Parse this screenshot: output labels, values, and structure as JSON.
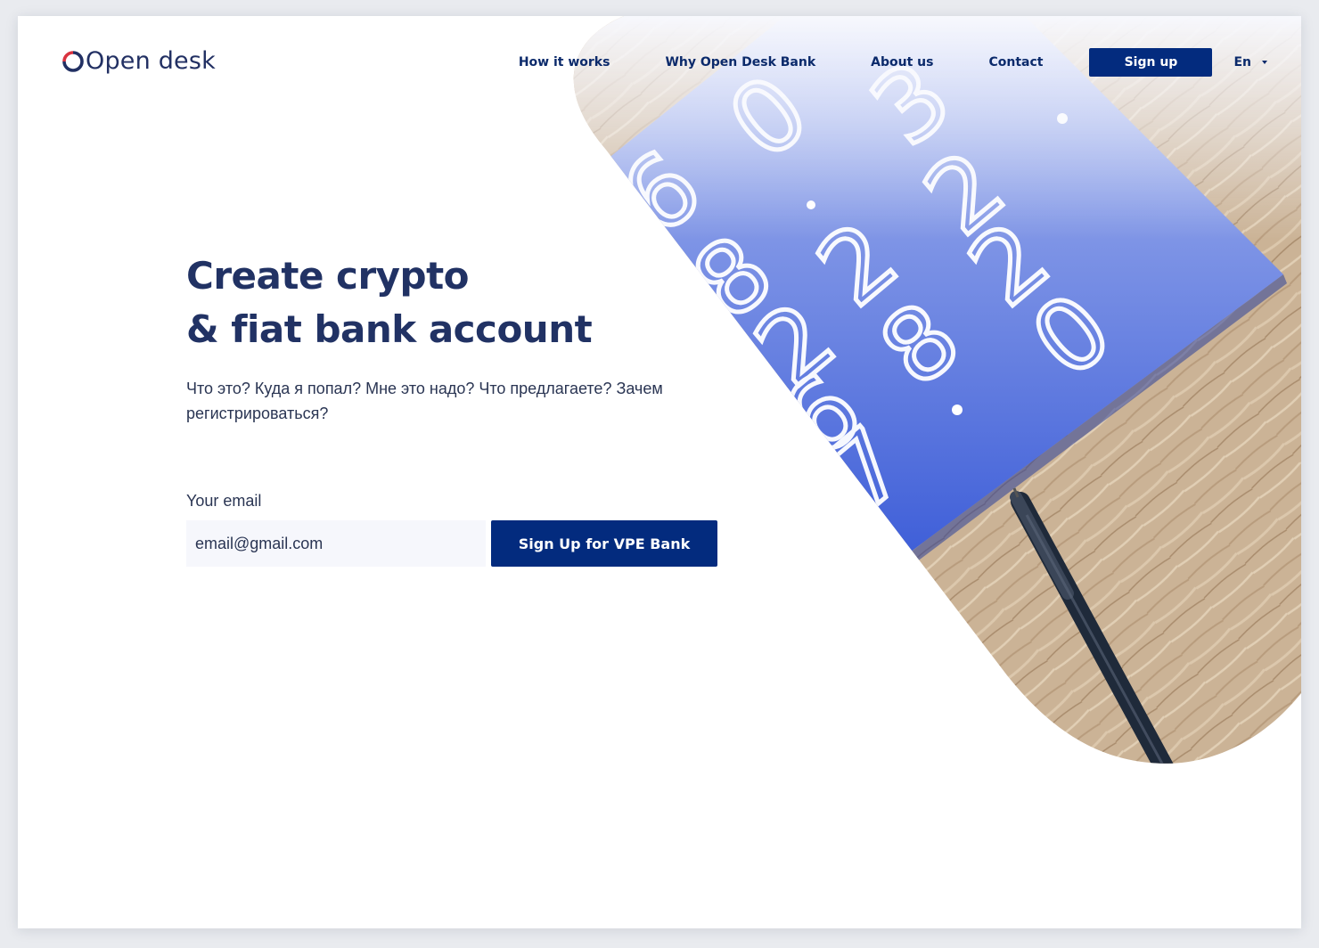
{
  "brand": {
    "logo_text": "Open desk",
    "logo_icon": "open-desk-logo-mark"
  },
  "nav": {
    "links": [
      "How it works",
      "Why Open Desk Bank",
      "About us",
      "Contact"
    ],
    "signup_label": "Sign up",
    "language": "En",
    "language_icon": "chevron-down-icon"
  },
  "hero": {
    "title_line1": "Create crypto",
    "title_line2": "& fiat bank account",
    "subtitle": "Что это? Куда я попал? Мне это надо? Что предлагаете? Зачем регистрироваться?"
  },
  "form": {
    "email_label": "Your email",
    "email_placeholder": "email@gmail.com",
    "submit_label": "Sign Up for VPE Bank"
  },
  "illustration": {
    "digits": [
      "0",
      "6",
      "3",
      "2",
      "1",
      "8",
      "2",
      "2",
      "0",
      "2",
      "8",
      "6",
      "7"
    ]
  },
  "colors": {
    "brand_navy": "#032b7e",
    "heading": "#213264",
    "logo_red": "#d9333f",
    "card_blue": "#4566dc",
    "wood": "#cdb79b",
    "input_bg": "#f6f7fc"
  }
}
